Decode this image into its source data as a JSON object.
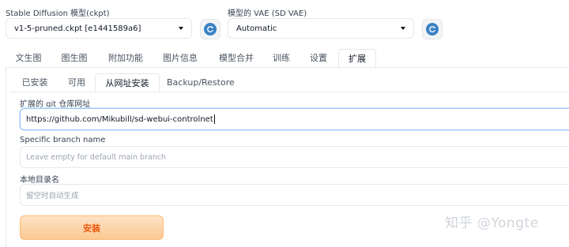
{
  "model": {
    "label": "Stable Diffusion 模型(ckpt)",
    "value": "v1-5-pruned.ckpt [e1441589a6]"
  },
  "vae": {
    "label": "模型的 VAE (SD VAE)",
    "value": "Automatic"
  },
  "main_tabs": [
    {
      "label": "文生图"
    },
    {
      "label": "图生图"
    },
    {
      "label": "附加功能"
    },
    {
      "label": "图片信息"
    },
    {
      "label": "模型合并"
    },
    {
      "label": "训练"
    },
    {
      "label": "设置"
    },
    {
      "label": "扩展",
      "active": true
    }
  ],
  "sub_tabs": [
    {
      "label": "已安装"
    },
    {
      "label": "可用"
    },
    {
      "label": "从网址安装",
      "active": true
    },
    {
      "label": "Backup/Restore"
    }
  ],
  "form": {
    "url_label": "扩展的 git 仓库网址",
    "url_value": "https://github.com/Mikubill/sd-webui-controlnet",
    "branch_label": "Specific branch name",
    "branch_placeholder": "Leave empty for default main branch",
    "dir_label": "本地目录名",
    "dir_placeholder": "留空时自动生成",
    "install_label": "安装"
  },
  "watermark": "知乎 @Yongte",
  "colors": {
    "accent_blue": "#3b82c4",
    "install_orange": "#ea580c",
    "install_bg": "#fbc892"
  }
}
